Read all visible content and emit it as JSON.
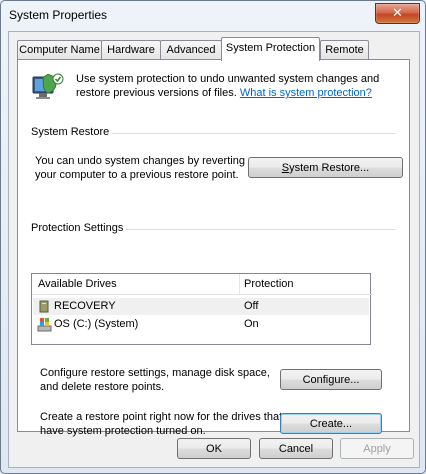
{
  "window": {
    "title": "System Properties",
    "close_label": "✕"
  },
  "tabs": [
    {
      "label": "Computer Name"
    },
    {
      "label": "Hardware"
    },
    {
      "label": "Advanced"
    },
    {
      "label": "System Protection",
      "active": true
    },
    {
      "label": "Remote"
    }
  ],
  "intro": {
    "text_line1": "Use system protection to undo unwanted system changes and",
    "text_line2": "restore previous versions of files.",
    "link": "What is system protection?"
  },
  "system_restore": {
    "heading": "System Restore",
    "desc_line1": "You can undo system changes by reverting",
    "desc_line2": "your computer to a previous restore point.",
    "button_ul": "S",
    "button_rest": "ystem Restore..."
  },
  "protection": {
    "heading": "Protection Settings",
    "columns": [
      "Available Drives",
      "Protection"
    ],
    "drives": [
      {
        "name": "RECOVERY",
        "protection": "Off",
        "icon": "drive-icon"
      },
      {
        "name": "OS (C:) (System)",
        "protection": "On",
        "icon": "windows-drive-icon"
      }
    ],
    "configure_desc_line1": "Configure restore settings, manage disk space,",
    "configure_desc_line2": "and delete restore points.",
    "configure_button": "Configure...",
    "create_desc_line1": "Create a restore point right now for the drives that",
    "create_desc_line2": "have system protection turned on.",
    "create_button": "Create..."
  },
  "footer": {
    "ok": "OK",
    "cancel": "Cancel",
    "apply": "Apply"
  }
}
